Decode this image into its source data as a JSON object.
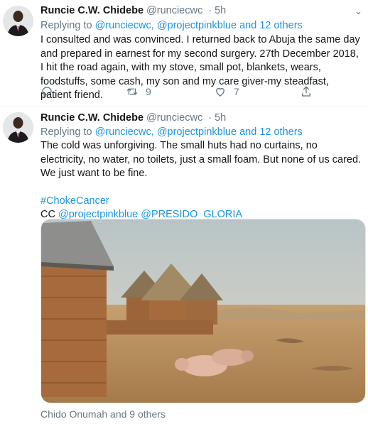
{
  "tweets": [
    {
      "author_name": "Runcie C.W. Chidebe",
      "author_handle": "@runciecwc",
      "time": "· 5h",
      "reply_prefix": "Replying to",
      "reply_to": "@runciecwc, @projectpinkblue and 12 others",
      "body": "I consulted and was convinced. I returned back to Abuja the same day and prepared in earnest for my second surgery. 27th December 2018, I hit the road again, with my stove, small pot, blankets, wears, foodstuffs, some cash, my son and my care giver-my steadfast, patient friend.",
      "retweet_count": "9",
      "like_count": "7",
      "icons": [
        "reply-icon",
        "retweet-icon",
        "like-icon",
        "share-icon",
        "chevron-down-icon"
      ]
    },
    {
      "author_name": "Runcie C.W. Chidebe",
      "author_handle": "@runciecwc",
      "time": "· 5h",
      "reply_prefix": "Replying to",
      "reply_to": "@runciecwc, @projectpinkblue and 12 others",
      "body": "The cold was unforgiving. The small huts had no curtains, no electricity, no water, no toilets, just a small foam. But none of us cared. We just want to be fine.",
      "hashtag": "#ChokeCancer",
      "cc_prefix": "CC",
      "cc_mentions": "@projectpinkblue @PRESIDO_GLORIA",
      "photo_subject": "mud-brick huts with thatched roofs and pigs on dry ground",
      "likers": "Chido Onumah and 9 others"
    }
  ],
  "colors": {
    "link": "#1b95e0",
    "muted": "#657786",
    "text": "#14171a",
    "divider": "#e6ecf0"
  }
}
